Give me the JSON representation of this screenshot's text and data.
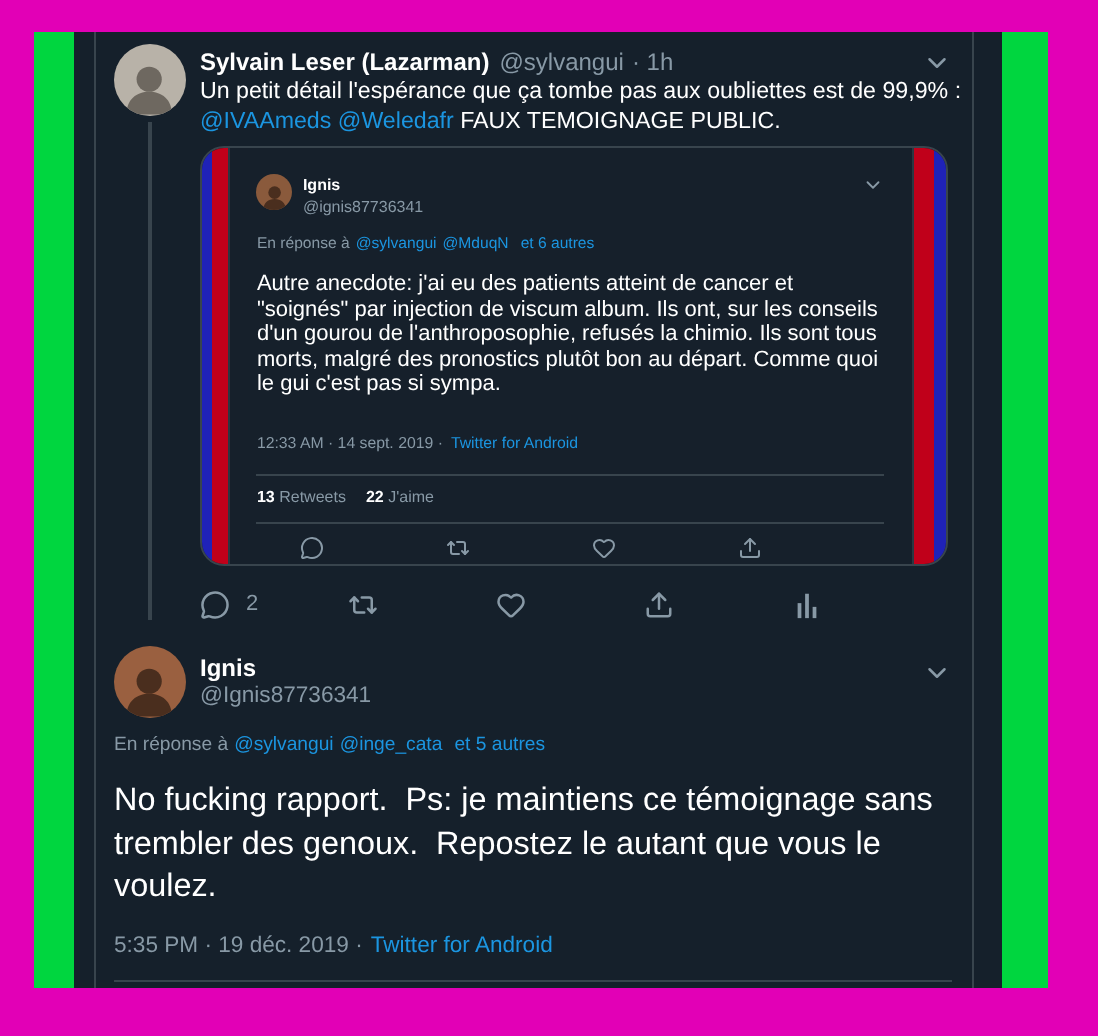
{
  "tweet": {
    "author": "Sylvain Leser (Lazarman)",
    "handle": "@sylvangui",
    "time": "· 1h",
    "text": [
      {
        "kind": "text",
        "value": "Un petit détail l'espérance que ça tombe pas aux oubliettes est de 99,9% :"
      },
      {
        "kind": "mention",
        "value": "@IVAAmeds"
      },
      {
        "kind": "mention",
        "value": "@Weledafr"
      },
      {
        "kind": "text",
        "value": "FAUX TEMOIGNAGE PUBLIC."
      }
    ],
    "quote": {
      "author": "Ignis",
      "handle": "@ignis87736341",
      "reply_prefix": "En réponse à",
      "reply_mentions": [
        "@sylvangui",
        "@MduqN"
      ],
      "reply_more": "et 6 autres",
      "text": "Autre anecdote: j'ai eu des patients atteint de cancer et \"soignés\" par injection de viscum album. Ils ont, sur les conseils d'un gourou de l'anthroposophie, refusés la chimio. Ils sont tous morts, malgré des pronostics plutôt bon au départ. Comme quoi le gui c'est pas si sympa.",
      "time": "12:33 AM · 14 sept. 2019 ·",
      "source": "Twitter for Android",
      "stats": [
        {
          "count": "13",
          "label": "Retweets"
        },
        {
          "count": "22",
          "label": "J'aime"
        }
      ]
    },
    "reply_count": "2"
  },
  "reply": {
    "author": "Ignis",
    "handle": "@Ignis87736341",
    "reply_prefix": "En réponse à",
    "reply_mentions": [
      "@sylvangui",
      "@inge_cata"
    ],
    "reply_more": "et 5 autres",
    "text": "No fucking rapport.  Ps: je maintiens ce témoignage sans trembler des genoux.  Repostez le autant que vous le voulez.",
    "time": "5:35 PM · 19 déc. 2019 ·",
    "source": "Twitter for Android"
  }
}
